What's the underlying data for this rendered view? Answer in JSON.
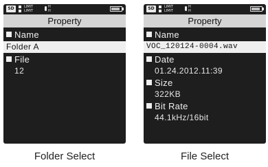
{
  "screens": [
    {
      "status": {
        "sd_label": "SD",
        "limit_line1": "LIMIT",
        "limit_line2": "LIMIT",
        "mode_line1": "H",
        "mode_line2": "H",
        "battery_level": 0.85
      },
      "title": "Property",
      "fields": [
        {
          "label": "Name",
          "value": "Folder A",
          "selected": true
        },
        {
          "label": "File",
          "value": "12",
          "selected": false
        }
      ],
      "caption": "Folder Select"
    },
    {
      "status": {
        "sd_label": "SD",
        "limit_line1": "LIMIT",
        "limit_line2": "LIMIT",
        "mode_line1": "H",
        "mode_line2": "H",
        "battery_level": 0.85
      },
      "title": "Property",
      "fields": [
        {
          "label": "Name",
          "value": "VOC_120124-0004.wav",
          "selected": true
        },
        {
          "label": "Date",
          "value": "01.24.2012.11:39",
          "selected": false
        },
        {
          "label": "Size",
          "value": "322KB",
          "selected": false
        },
        {
          "label": "Bit Rate",
          "value": "44.1kHz/16bit",
          "selected": false
        }
      ],
      "caption": "File Select"
    }
  ],
  "colors": {
    "screen_bg": "#1e1e1e",
    "titlebar_bg": "#d4d4d4",
    "highlight_bg": "#efefef",
    "text_light": "#efefef"
  }
}
